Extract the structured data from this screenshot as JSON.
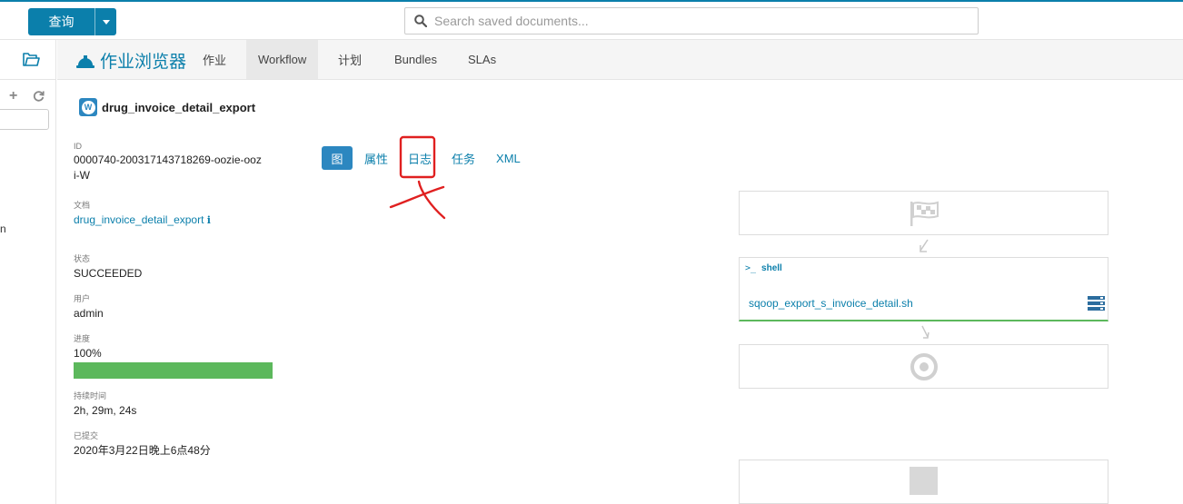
{
  "topbar": {
    "query_label": "查询",
    "search_placeholder": "Search saved documents..."
  },
  "leftpanel": {
    "partial_letter": "n"
  },
  "navbar": {
    "brand": "作业浏览器",
    "tabs": [
      {
        "label": "作业",
        "active": false
      },
      {
        "label": "Workflow",
        "active": true
      },
      {
        "label": "计划",
        "active": false
      },
      {
        "label": "Bundles",
        "active": false
      },
      {
        "label": "SLAs",
        "active": false
      }
    ]
  },
  "workflow": {
    "badge": "W",
    "title": "drug_invoice_detail_export"
  },
  "meta": {
    "id_label": "ID",
    "id_line1": "0000740-200317143718269-oozie-ooz",
    "id_line2": "i-W",
    "doc_label": "文档",
    "doc_value": "drug_invoice_detail_export",
    "status_label": "状态",
    "status_value": "SUCCEEDED",
    "user_label": "用户",
    "user_value": "admin",
    "progress_label": "进度",
    "progress_value": "100%",
    "progress_fraction": 1.0,
    "duration_label": "持续时间",
    "duration_value": "2h, 29m, 24s",
    "submitted_label": "已提交",
    "submitted_value": "2020年3月22日晚上6点48分"
  },
  "tabs": [
    {
      "label": "图",
      "active": true
    },
    {
      "label": "属性",
      "active": false
    },
    {
      "label": "日志",
      "active": false
    },
    {
      "label": "任务",
      "active": false
    },
    {
      "label": "XML",
      "active": false
    }
  ],
  "graph": {
    "action_type": "shell",
    "action_name": "sqoop_export_s_invoice_detail.sh",
    "status_color": "#5cb85c"
  },
  "colors": {
    "accent": "#0b7fab",
    "success": "#5cb85c",
    "annotation": "#e02020"
  }
}
